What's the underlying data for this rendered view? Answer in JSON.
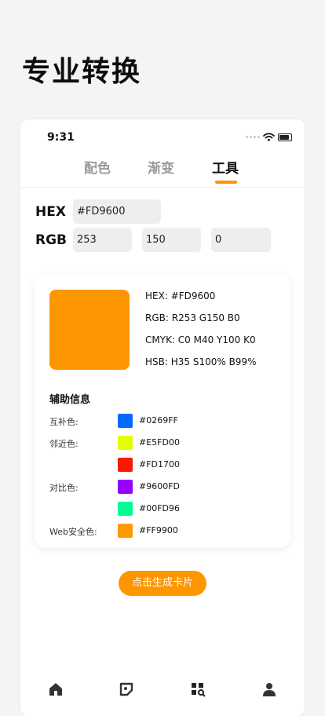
{
  "promo": {
    "title": "专业转换"
  },
  "status": {
    "time": "9:31"
  },
  "tabs": [
    {
      "label": "配色",
      "active": false
    },
    {
      "label": "渐变",
      "active": false
    },
    {
      "label": "工具",
      "active": true
    }
  ],
  "inputs": {
    "hex_label": "HEX",
    "hex_value": "#FD9600",
    "rgb_label": "RGB",
    "r": "253",
    "g": "150",
    "b": "0"
  },
  "result": {
    "swatch_color": "#FD9600",
    "hex": "HEX: #FD9600",
    "rgb": "RGB: R253 G150 B0",
    "cmyk": "CMYK: C0 M40 Y100 K0",
    "hsb": "HSB: H35 S100% B99%"
  },
  "aux": {
    "title": "辅助信息",
    "rows": [
      {
        "label": "互补色:",
        "color": "#0269FF",
        "code": "#0269FF"
      },
      {
        "label": "邻近色:",
        "color": "#E5FD00",
        "code": "#E5FD00"
      },
      {
        "label": "",
        "color": "#FD1700",
        "code": "#FD1700"
      },
      {
        "label": "对比色:",
        "color": "#9600FD",
        "code": "#9600FD"
      },
      {
        "label": "",
        "color": "#00FD96",
        "code": "#00FD96"
      },
      {
        "label": "Web安全色:",
        "color": "#FF9900",
        "code": "#FF9900"
      }
    ]
  },
  "actions": {
    "generate_label": "点击生成卡片"
  },
  "accent_color": "#FD9600",
  "tab_bar": [
    {
      "icon": "home-icon"
    },
    {
      "icon": "palette-icon"
    },
    {
      "icon": "grid-search-icon",
      "active": true
    },
    {
      "icon": "user-icon"
    }
  ]
}
